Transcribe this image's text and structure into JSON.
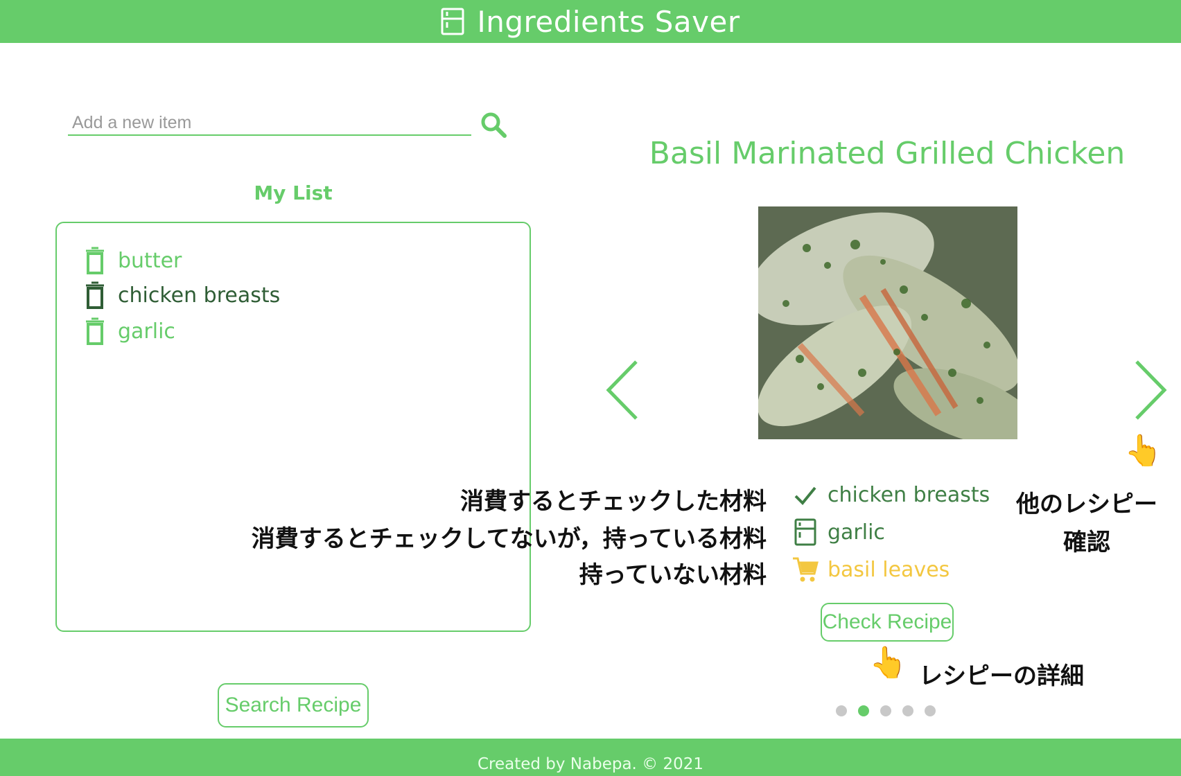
{
  "app": {
    "title": "Ingredients Saver",
    "logo_icon": "fridge-icon"
  },
  "search": {
    "placeholder": "Add a new item",
    "value": "",
    "button_icon": "search-icon"
  },
  "my_list": {
    "heading": "My List",
    "items": [
      {
        "label": "butter",
        "color": "#66cc6a",
        "icon": "trash-icon"
      },
      {
        "label": "chicken breasts",
        "color": "#2f5d35",
        "icon": "trash-icon"
      },
      {
        "label": "garlic",
        "color": "#66cc6a",
        "icon": "trash-icon"
      }
    ]
  },
  "search_recipe_label": "Search Recipe",
  "recipe": {
    "title": "Basil Marinated Grilled Chicken",
    "ingredients": [
      {
        "label": "chicken breasts",
        "icon": "check-icon",
        "color": "#3f7f45"
      },
      {
        "label": "garlic",
        "icon": "fridge-icon",
        "color": "#3f7f45"
      },
      {
        "label": "basil leaves",
        "icon": "cart-icon",
        "color": "#f3c740"
      }
    ],
    "check_recipe_label": "Check Recipe",
    "prev_icon": "chevron-left-icon",
    "next_icon": "chevron-right-icon",
    "carousel": {
      "count": 5,
      "active": 2
    }
  },
  "annotations": {
    "checked": "消費するとチェックした材料",
    "unchecked_owned": "消費するとチェックしてないが，持っている材料",
    "not_owned": "持っていない材料",
    "other_recipes_1": "他のレシピー",
    "other_recipes_2": "確認",
    "recipe_detail": "レシピーの詳細",
    "pointer_icon": "pointing-hand-icon"
  },
  "footer": {
    "text": "Created by Nabepa. © 2021"
  },
  "colors": {
    "brand": "#66cc6a",
    "dark_green": "#2f5d35",
    "yellow": "#f3c740"
  }
}
